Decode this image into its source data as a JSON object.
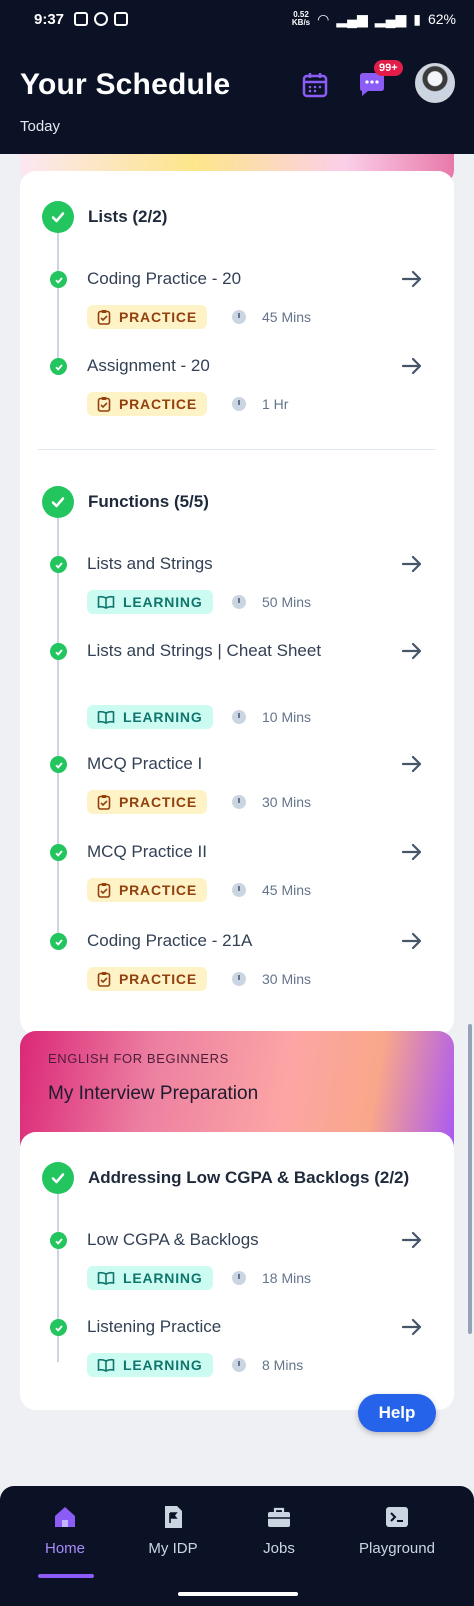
{
  "statusbar": {
    "time": "9:37",
    "net_speed_value": "0.52",
    "net_speed_unit": "KB/s",
    "battery": "62%"
  },
  "header": {
    "title": "Your Schedule",
    "subtitle": "Today",
    "badge": "99+"
  },
  "card1": {
    "groups": [
      {
        "title": "Lists (2/2)",
        "items": [
          {
            "title": "Coding Practice - 20",
            "tag": "PRACTICE",
            "duration": "45 Mins"
          },
          {
            "title": "Assignment - 20",
            "tag": "PRACTICE",
            "duration": "1 Hr"
          }
        ]
      },
      {
        "title": "Functions (5/5)",
        "items": [
          {
            "title": "Lists and Strings",
            "tag": "LEARNING",
            "duration": "50 Mins"
          },
          {
            "title": "Lists and Strings | Cheat Sheet",
            "tag": "LEARNING",
            "duration": "10 Mins"
          },
          {
            "title": "MCQ Practice I",
            "tag": "PRACTICE",
            "duration": "30 Mins"
          },
          {
            "title": "MCQ Practice II",
            "tag": "PRACTICE",
            "duration": "45 Mins"
          },
          {
            "title": "Coding Practice - 21A",
            "tag": "PRACTICE",
            "duration": "30 Mins"
          }
        ]
      }
    ]
  },
  "card2": {
    "label": "ENGLISH FOR BEGINNERS",
    "name": "My Interview Preparation",
    "groups": [
      {
        "title": "Addressing Low CGPA & Backlogs (2/2)",
        "items": [
          {
            "title": "Low CGPA & Backlogs",
            "tag": "LEARNING",
            "duration": "18 Mins"
          },
          {
            "title": "Listening Practice",
            "tag": "LEARNING",
            "duration": "8 Mins"
          }
        ]
      }
    ]
  },
  "help": "Help",
  "nav": [
    {
      "label": "Home",
      "active": true
    },
    {
      "label": "My IDP",
      "active": false
    },
    {
      "label": "Jobs",
      "active": false
    },
    {
      "label": "Playground",
      "active": false
    }
  ],
  "colors": {
    "accent": "#8b5cf6",
    "success": "#22c55e",
    "practice_bg": "#fef3c7",
    "learning_bg": "#ccfbf1",
    "header_bg": "#0b1226"
  }
}
